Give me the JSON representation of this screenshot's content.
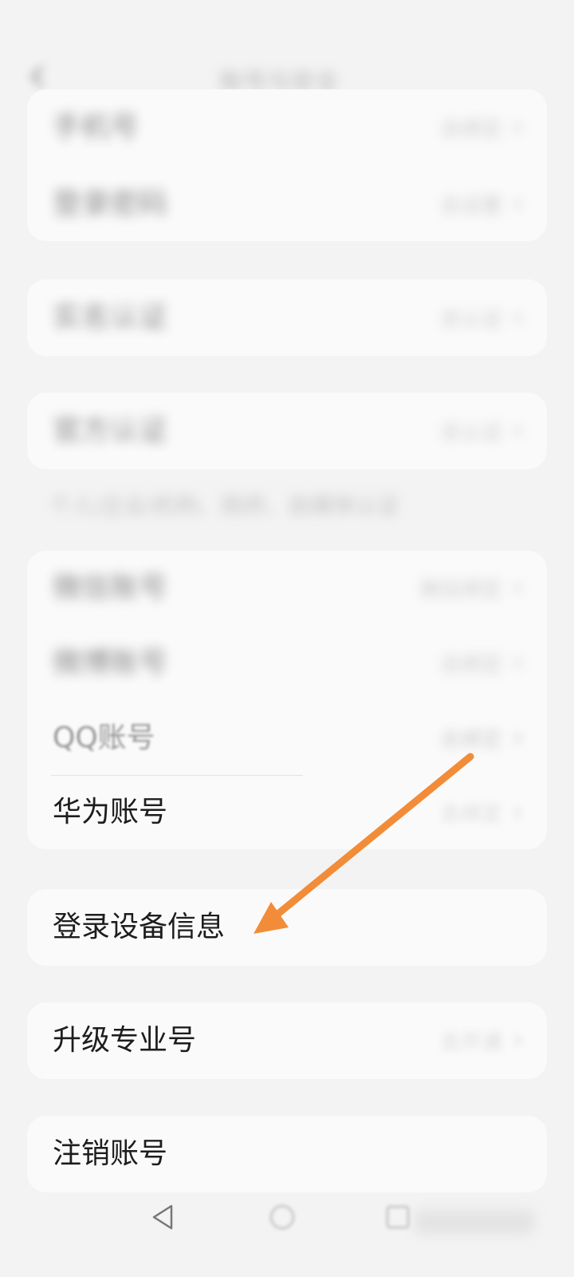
{
  "header": {
    "title": "账号与安全"
  },
  "cards": {
    "basic": {
      "items": [
        {
          "label": "手机号",
          "value": "去绑定"
        },
        {
          "label": "登录密码",
          "value": "去设置"
        }
      ]
    },
    "identity": {
      "items": [
        {
          "label": "实名认证",
          "value": "去认证"
        }
      ]
    },
    "verification": {
      "items": [
        {
          "label": "官方认证",
          "value": "去认证"
        }
      ],
      "note": "个人/企业/机构、政府、自媒体认证"
    },
    "third_party": {
      "items": [
        {
          "label": "微信账号",
          "value": "微信绑定"
        },
        {
          "label": "微博账号",
          "value": "去绑定"
        },
        {
          "label": "QQ账号",
          "value": "去绑定"
        },
        {
          "label": "华为账号",
          "value": "去绑定"
        }
      ]
    },
    "device": {
      "label": "登录设备信息"
    },
    "upgrade": {
      "label": "升级专业号",
      "value": "去开通"
    },
    "cancel": {
      "label": "注销账号"
    }
  },
  "annotation": {
    "arrow_color": "#F28C38"
  },
  "icons": {
    "back": "chevron-left-icon",
    "row_chevron": "chevron-right-icon",
    "nav_back": "triangle-back-icon",
    "nav_home": "circle-home-icon",
    "nav_recent": "square-recent-icon"
  }
}
